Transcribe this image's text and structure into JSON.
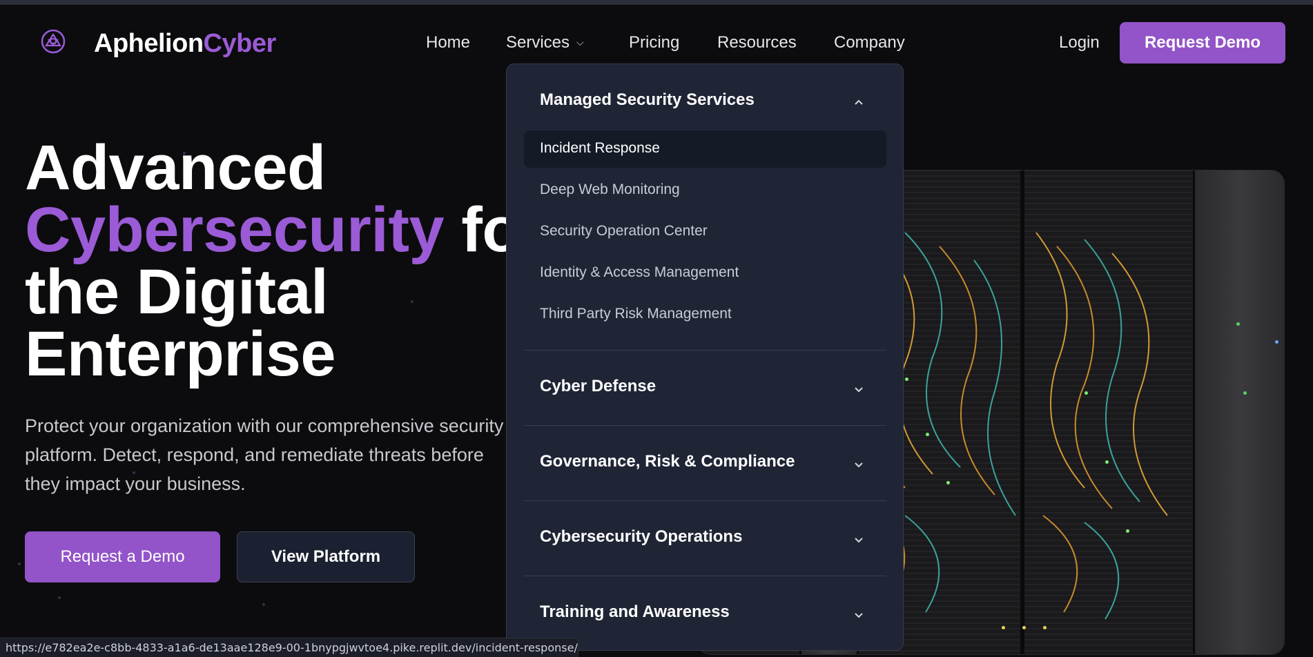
{
  "brand": {
    "name_part1": "Aphelion",
    "name_part2": "Cyber",
    "accent_color": "#9b5bd6"
  },
  "nav": {
    "items": [
      {
        "label": "Home"
      },
      {
        "label": "Services",
        "has_dropdown": true,
        "dropdown_icon": "chevron-down-icon"
      },
      {
        "label": "Pricing"
      },
      {
        "label": "Resources"
      },
      {
        "label": "Company"
      }
    ],
    "login_label": "Login",
    "request_demo_label": "Request Demo"
  },
  "hero": {
    "title_line1": "Advanced",
    "title_accent": "Cybersecurity",
    "title_line2_rest": " for",
    "title_line3": "the Digital",
    "title_line4": "Enterprise",
    "description": "Protect your organization with our comprehensive security platform. Detect, respond, and remediate threats before they impact your business.",
    "primary_button": "Request a Demo",
    "secondary_button": "View Platform"
  },
  "services_dropdown": {
    "sections": [
      {
        "title": "Managed Security Services",
        "expanded": true,
        "items": [
          "Incident Response",
          "Deep Web Monitoring",
          "Security Operation Center",
          "Identity & Access Management",
          "Third Party Risk Management"
        ],
        "hovered_item": "Incident Response"
      },
      {
        "title": "Cyber Defense",
        "expanded": false
      },
      {
        "title": "Governance, Risk & Compliance",
        "expanded": false
      },
      {
        "title": "Cybersecurity Operations",
        "expanded": false
      },
      {
        "title": "Training and Awareness",
        "expanded": false
      }
    ]
  },
  "status_bar": {
    "url": "https://e782ea2e-c8bb-4833-a1a6-de13aae128e9-00-1bnypgjwvtoe4.pike.replit.dev/incident-response/"
  }
}
